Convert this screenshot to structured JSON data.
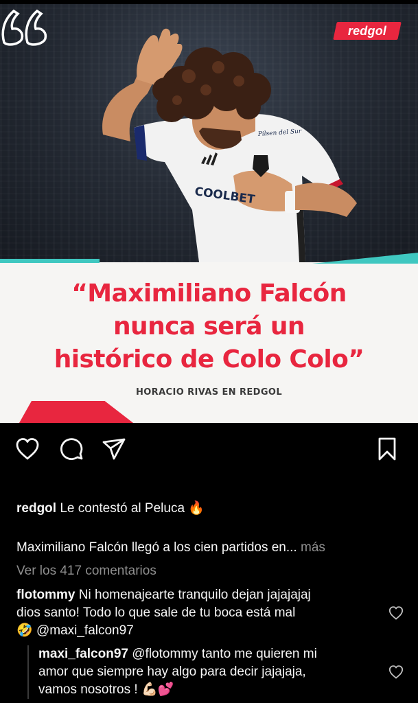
{
  "post": {
    "brand_logo": "redgol",
    "headline_lines": [
      "“Maximiliano Falcón",
      "nunca será un",
      "histórico de Colo Colo”"
    ],
    "byline": "HORACIO RIVAS EN REDGOL",
    "jersey_sponsor": "COOLBET",
    "jersey_brand": "Pilsen del Sur"
  },
  "actions": {
    "like_icon": "heart-icon",
    "comment_icon": "comment-icon",
    "share_icon": "send-icon",
    "save_icon": "bookmark-icon"
  },
  "caption": {
    "username": "redgol",
    "text": "Le contestó al Peluca",
    "emoji": "🔥"
  },
  "description": {
    "text": "Maximiliano Falcón llegó a los cien partidos en...",
    "more_label": "más"
  },
  "view_comments": "Ver los 417 comentarios",
  "comments": [
    {
      "username": "flotommy",
      "line1": "Ni homenajearte tranquilo dejan jajajajaj",
      "line2": "dios santo! Todo lo que sale de tu boca está mal",
      "emoji": "🤣",
      "mention": "@maxi_falcon97"
    },
    {
      "username": "maxi_falcon97",
      "line1": "@flotommy tanto me quieren mi",
      "line2": "amor que siempre hay algo para decir jajajaja,",
      "line3": "vamos nosotros !",
      "emoji": "💪🏻💕"
    }
  ],
  "colors": {
    "accent_red": "#e8263f",
    "accent_teal": "#3fc7c0",
    "text_secondary": "#8e8e8e"
  }
}
